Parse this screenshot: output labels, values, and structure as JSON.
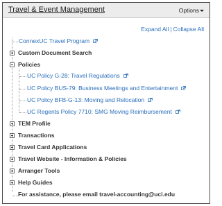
{
  "portlet": {
    "title": "Travel & Event Management",
    "options_label": "Options"
  },
  "toolbar": {
    "expand_all": "Expand All",
    "separator": "|",
    "collapse_all": "Collapse All"
  },
  "tree": {
    "top_link": "ConnexUC Travel Program",
    "custom_document_search": "Custom Document Search",
    "policies": {
      "label": "Policies",
      "items": [
        "UC Policy G-28: Travel Regulations",
        "UC Policy BUS-79: Business Meetings and Entertainment",
        "UC Policy BFB-G-13: Moving and Relocation",
        "UC Regents Policy 7710: SMG Moving Reimbursement"
      ]
    },
    "categories": [
      "TEM Profile",
      "Transactions",
      "Travel Card Applications",
      "Travel Website - Information & Policies",
      "Arranger Tools",
      "Help Guides"
    ],
    "assistance": "For assistance, please email travel-accounting@uci.edu"
  },
  "icons": {
    "expander_collapsed": "plus-box-icon",
    "expander_expanded": "minus-box-icon",
    "external_link": "external-link-icon",
    "dropdown": "caret-down-icon"
  },
  "colors": {
    "link": "#2a6ebb",
    "text": "#333333",
    "header_bg": "#ececec"
  }
}
